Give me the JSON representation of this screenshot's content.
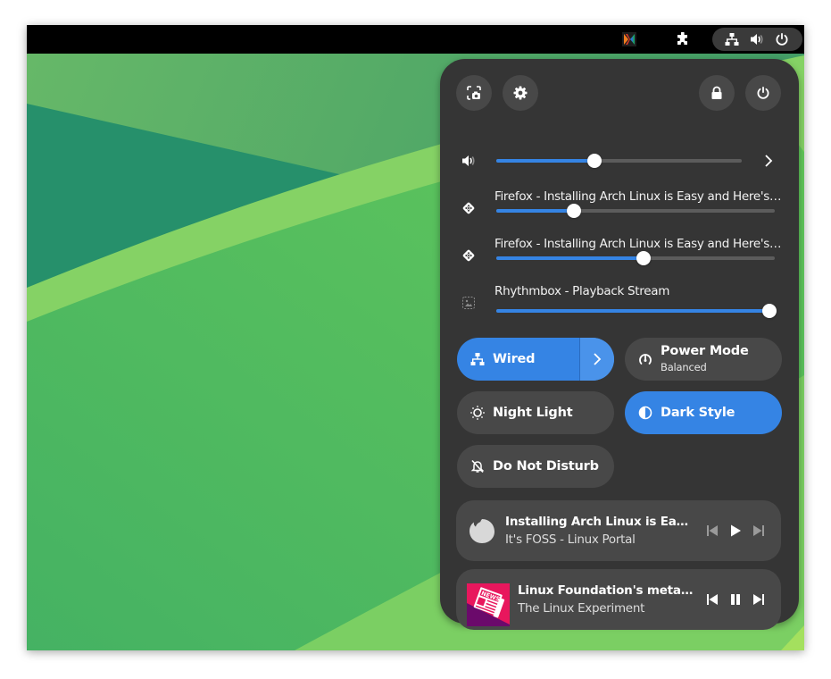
{
  "topbar": {
    "app_icon": "xournal-app-icon",
    "extensions_icon": "puzzle-icon",
    "status_icons": [
      "network-wired-icon",
      "volume-icon",
      "power-icon"
    ]
  },
  "quick_settings": {
    "top_buttons": [
      {
        "name": "screenshot-button",
        "icon": "screenshot-icon"
      },
      {
        "name": "settings-button",
        "icon": "gear-icon"
      },
      {
        "name": "lock-button",
        "icon": "lock-icon"
      },
      {
        "name": "power-menu-button",
        "icon": "power-icon"
      }
    ],
    "master_volume": {
      "icon": "volume-icon",
      "value_percent": 40,
      "expand_icon": "chevron-right-icon"
    },
    "app_volumes": [
      {
        "label": "Firefox - Installing Arch Linux is Easy and Here's the…",
        "icon": "application-icon",
        "value_percent": 28
      },
      {
        "label": "Firefox - Installing Arch Linux is Easy and Here's the…",
        "icon": "application-icon",
        "value_percent": 53
      },
      {
        "label": "Rhythmbox - Playback Stream",
        "icon": "image-missing-icon",
        "value_percent": 100
      }
    ],
    "toggles": [
      {
        "label": "Wired",
        "icon": "network-wired-icon",
        "active": true,
        "has_menu": true
      },
      {
        "label": "Power Mode",
        "subtitle": "Balanced",
        "icon": "power-profile-icon",
        "active": false
      },
      {
        "label": "Night Light",
        "icon": "night-light-icon",
        "active": false
      },
      {
        "label": "Dark Style",
        "icon": "dark-style-icon",
        "active": true
      },
      {
        "label": "Do Not Disturb",
        "icon": "notifications-disabled-icon",
        "active": false
      }
    ],
    "media_players": [
      {
        "title": "Installing Arch Linux is Easy and…",
        "artist": "It's FOSS - Linux Portal",
        "art": "firefox-icon",
        "state": "paused",
        "controls": [
          "previous-icon",
          "play-icon",
          "next-icon"
        ]
      },
      {
        "title": "Linux Foundation's metaverse…",
        "artist": "The Linux Experiment",
        "art": "news-album-art",
        "state": "playing",
        "controls": [
          "previous-icon",
          "pause-icon",
          "next-icon"
        ]
      }
    ]
  },
  "colors": {
    "accent": "#3584e4",
    "panel_bg": "#353535",
    "button_bg": "#484848",
    "topbar_bg": "#000000"
  }
}
